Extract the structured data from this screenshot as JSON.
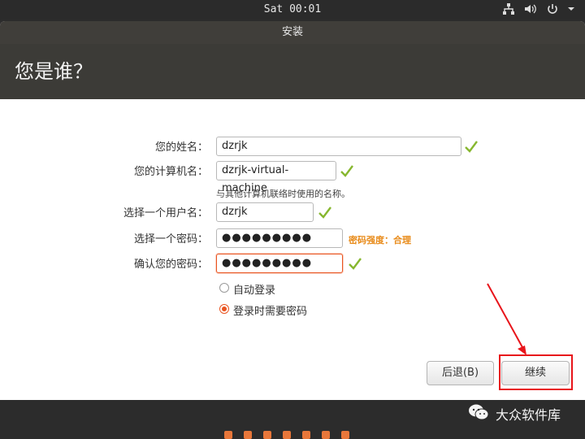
{
  "topbar": {
    "clock": "Sat 00:01"
  },
  "window": {
    "title": "安装",
    "heading": "您是谁？"
  },
  "form": {
    "name_label": "您的姓名：",
    "name_value": "dzrjk",
    "computer_label": "您的计算机名：",
    "computer_value": "dzrjk-virtual-machine",
    "computer_hint": "与其他计算机联络时使用的名称。",
    "username_label": "选择一个用户名：",
    "username_value": "dzrjk",
    "password_label": "选择一个密码：",
    "password_value": "●●●●●●●●●",
    "password_strength": "密码强度：合理",
    "confirm_label": "确认您的密码：",
    "confirm_value": "●●●●●●●●●"
  },
  "login": {
    "auto_label": "自动登录",
    "require_label": "登录时需要密码"
  },
  "buttons": {
    "back": "后退(B)",
    "continue": "继续"
  },
  "watermark": {
    "text": "大众软件库"
  },
  "colors": {
    "accent": "#e95420",
    "check": "#87b72f",
    "annotation": "#e8151b"
  },
  "icons": [
    "network-icon",
    "volume-icon",
    "power-icon",
    "chevron-down-icon",
    "check-icon",
    "wechat-icon"
  ]
}
